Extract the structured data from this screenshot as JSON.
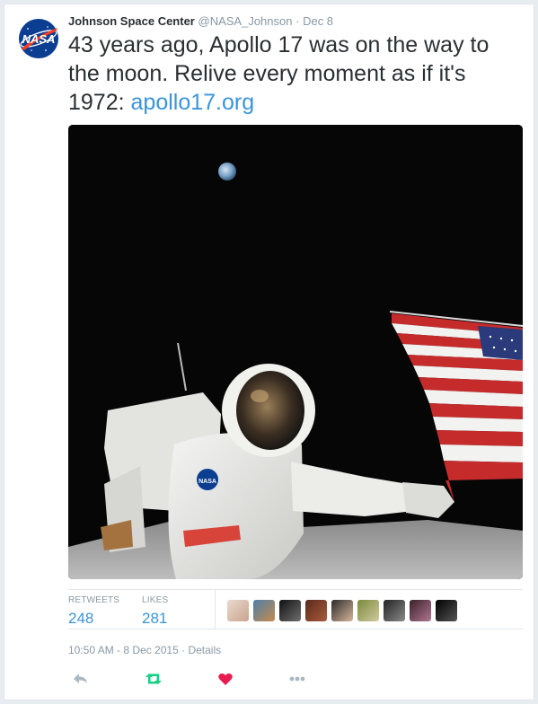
{
  "tweet": {
    "author_name": "Johnson Space Center",
    "handle": "@NASA_Johnson",
    "separator": "·",
    "date": "Dec 8",
    "text": "43 years ago, Apollo 17 was on the way to the moon. Relive every moment as if it's 1972: ",
    "link": "apollo17.org",
    "avatar_icon": "nasa-logo-icon",
    "media": "photo of astronaut saluting beside American flag on lunar surface with Earth in the sky"
  },
  "stats": {
    "retweets_label": "RETWEETS",
    "retweets_value": "248",
    "likes_label": "LIKES",
    "likes_value": "281",
    "likers_count": 9
  },
  "meta": {
    "timestamp": "10:50 AM - 8 Dec 2015",
    "separator": "·",
    "details": "Details"
  },
  "actions": {
    "reply_icon": "reply-icon",
    "retweet_icon": "retweet-icon",
    "like_icon": "heart-icon",
    "more_icon": "more-icon"
  },
  "colors": {
    "link": "#3b94d9",
    "muted": "#8899a6",
    "retweet": "#19cf86",
    "heart": "#e81c4f",
    "nasa_blue": "#0b3d91"
  }
}
